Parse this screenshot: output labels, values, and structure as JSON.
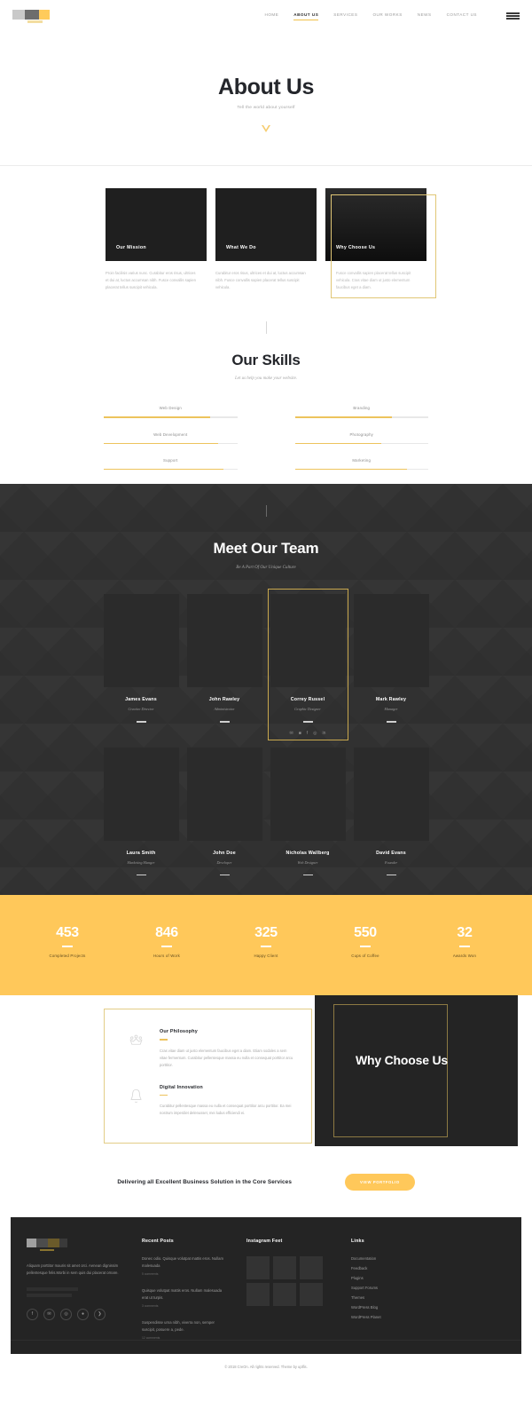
{
  "header": {
    "logo_name": "creon-logo",
    "nav": [
      {
        "label": "HOME",
        "active": false
      },
      {
        "label": "ABOUT US",
        "active": true
      },
      {
        "label": "SERVICES",
        "active": false
      },
      {
        "label": "OUR WORKS",
        "active": false
      },
      {
        "label": "NEWS",
        "active": false
      },
      {
        "label": "CONTACT US",
        "active": false
      }
    ],
    "menu_icon": "hamburger-menu-icon"
  },
  "hero": {
    "title": "About Us",
    "subtitle": "Tell the world about yourself",
    "scroll_icon": "triangle-down-icon"
  },
  "cards": [
    {
      "title": "Our Mission",
      "text": "Proin facilisis varius nunc. Curabitur eros risus, ultrices et dui at, luctus accumsan nibh. Fusce convallis sapien placerat tellus suscipit vehicula.",
      "highlighted": false
    },
    {
      "title": "What We Do",
      "text": "Curabitur eros risus, ultrices et dui at, luctus accumsan nibh. Fusce convallis sapien placerat tellus suscipit vehicula.",
      "highlighted": false
    },
    {
      "title": "Why Choose Us",
      "text": "Fusce convallis sapien placerat tellus suscipit vehicula. Cras vitae diam ut justo elementum faucibus eget a diam.",
      "highlighted": true
    }
  ],
  "skills": {
    "title": "Our Skills",
    "subtitle": "Let us help you make your website.",
    "items": [
      {
        "label": "Web Design",
        "percent": 80
      },
      {
        "label": "Branding",
        "percent": 73
      },
      {
        "label": "Web Development",
        "percent": 86
      },
      {
        "label": "Photography",
        "percent": 65
      },
      {
        "label": "Support",
        "percent": 90
      },
      {
        "label": "Marketing",
        "percent": 84
      }
    ]
  },
  "team": {
    "title": "Meet Our Team",
    "subtitle": "Be A Part Of Our Unique Culture",
    "social_icons": [
      "twitter-icon",
      "behance-icon",
      "facebook-icon",
      "instagram-icon",
      "linkedin-icon"
    ],
    "social_glyphs": [
      "✉",
      "■",
      "f",
      "◎",
      "in"
    ],
    "row1": [
      {
        "name": "James Evans",
        "role": "Creative Director",
        "active": false
      },
      {
        "name": "John Rawley",
        "role": "Administrator",
        "active": false
      },
      {
        "name": "Correy Russel",
        "role": "Graphic Designer",
        "active": true
      },
      {
        "name": "Mark Rawley",
        "role": "Manager",
        "active": false
      }
    ],
    "row2": [
      {
        "name": "Laura Smith",
        "role": "Marketing Manger",
        "active": false
      },
      {
        "name": "John Doe",
        "role": "Developer",
        "active": false
      },
      {
        "name": "Nicholas Wallberg",
        "role": "Web Designer",
        "active": false
      },
      {
        "name": "David Evans",
        "role": "Founder",
        "active": false
      }
    ]
  },
  "counters": [
    {
      "value": "453",
      "label": "Completed Projects"
    },
    {
      "value": "846",
      "label": "Hours of Work"
    },
    {
      "value": "325",
      "label": "Happy Client"
    },
    {
      "value": "550",
      "label": "Cups of Coffee"
    },
    {
      "value": "32",
      "label": "Awards Won"
    }
  ],
  "philosophy": [
    {
      "icon": "crown-icon",
      "title": "Our Philosophy",
      "text": "Cras vitae diam ut justo elementum faucibus eget a diam. Etiam sodales a sem vitae fermentum. Curabitur pellentesque massa eu nulla et consequat porttitor arcu porttitor."
    },
    {
      "icon": "bell-icon",
      "title": "Digital Innovation",
      "text": "Curabitur pellentesque massa eu nulla et consequat porttitor arcu porttitor. Ea mei nostrum imperdiet delenusset, mei ludus efficiendi ei."
    }
  ],
  "why_panel": {
    "title": "Why Choose Us"
  },
  "cta": {
    "text": "Delivering all Excellent Business Solution in the Core Services",
    "button": "VIEW PORTFOLIO"
  },
  "footer": {
    "logo_name": "creon-footer-logo",
    "description": "Aliquam porttitor mauris sit amet orci. Aenean dignissim pellentesque felis.Morbi in sem quis dui placerat ornare.",
    "social_icons": [
      "facebook-icon",
      "twitter-icon",
      "instagram-icon",
      "dribbble-icon",
      "behance-icon"
    ],
    "social_glyphs": [
      "f",
      "✉",
      "◎",
      "●",
      "❯"
    ],
    "recent_posts_title": "Recent Posts",
    "posts": [
      {
        "text": "Donec odio. Quisque volutpat mattis eros. Nullam malesuada",
        "comments": "5 comments"
      },
      {
        "text": "Quisque volutpat mattis eros. Nullam malesuada erat ut turpis.",
        "comments": "3 comments"
      },
      {
        "text": "Suspendisse urna nibh, viverra non, semper suscipit, posuere a, pede.",
        "comments": "12 comments"
      }
    ],
    "instagram_title": "Instagram Feet",
    "instagram_count": 6,
    "links_title": "Links",
    "links": [
      "Documentation",
      "Feedback",
      "Plugins",
      "Support Forums",
      "Themes",
      "WordPress Blog",
      "WordPress Planet"
    ],
    "copyright": "© 2018 CreOn. All rights reserved. Theme by uplfis."
  },
  "colors": {
    "accent": "#ffc85a",
    "accent_line": "#edc35c",
    "dark": "#242424",
    "team_bg": "#313131"
  }
}
